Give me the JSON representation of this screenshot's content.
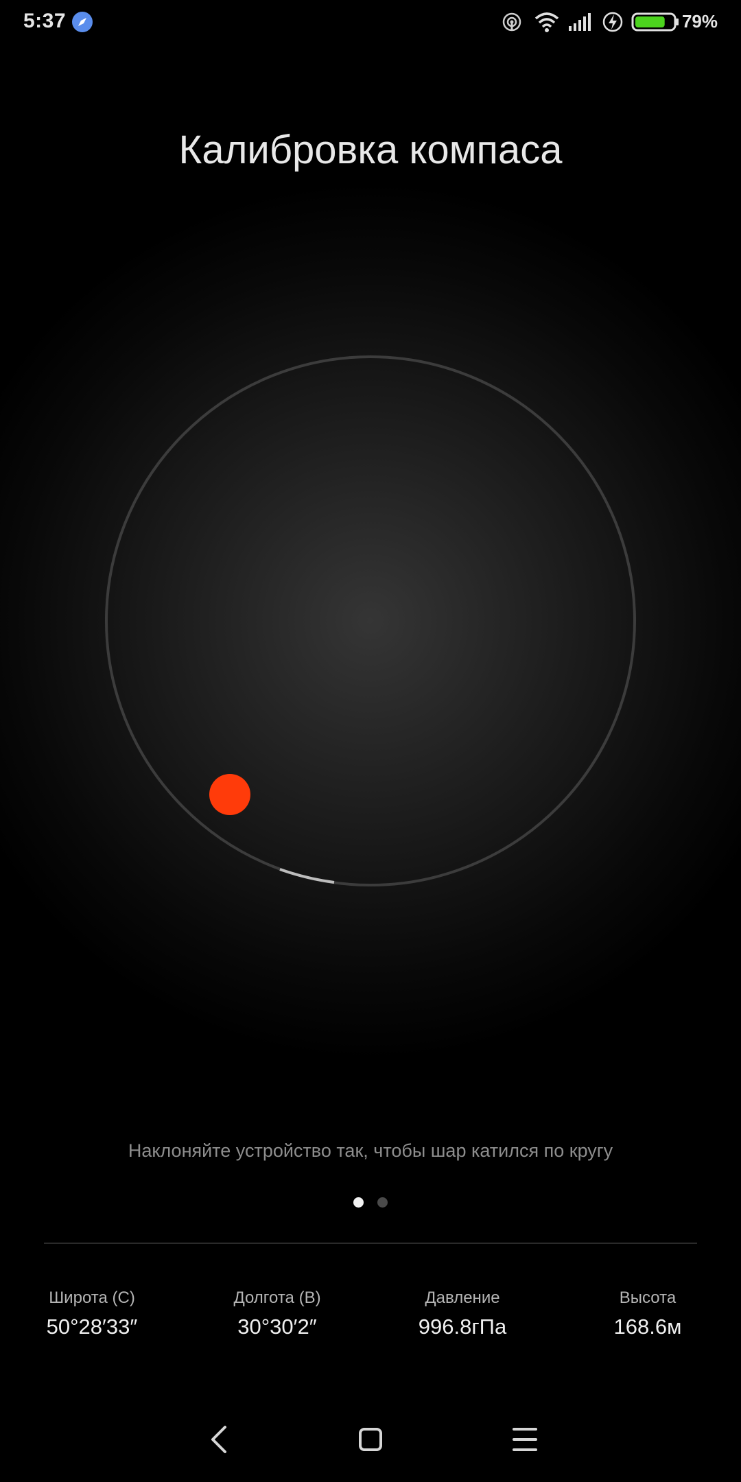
{
  "status_bar": {
    "time": "5:37",
    "battery_percent": "79%",
    "battery_level": 0.79,
    "battery_color": "#4cd41e",
    "icons": [
      "compass-app-icon",
      "hotspot-icon",
      "wifi-icon",
      "signal-icon",
      "charging-icon",
      "battery-icon"
    ]
  },
  "page": {
    "title": "Калибровка компаса",
    "instruction": "Наклоняйте устройство так, чтобы шар катился по кругу",
    "ball_color": "#ff3b0a",
    "page_index": 1,
    "page_count": 2
  },
  "info": [
    {
      "label": "Широта (С)",
      "value": "50°28′33″"
    },
    {
      "label": "Долгота (В)",
      "value": "30°30′2″"
    },
    {
      "label": "Давление",
      "value": "996.8гПа"
    },
    {
      "label": "Высота",
      "value": "168.6м"
    }
  ],
  "nav": {
    "icons": [
      "back-icon",
      "home-icon",
      "menu-icon"
    ]
  }
}
